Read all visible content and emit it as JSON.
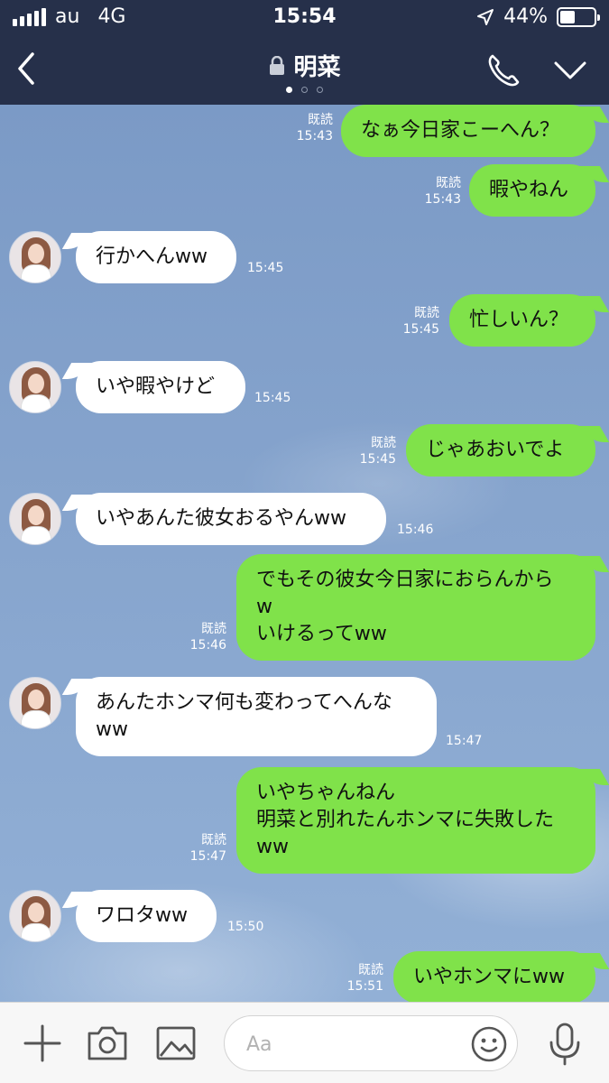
{
  "status": {
    "carrier": "au",
    "network": "4G",
    "time": "15:54",
    "battery": "44%",
    "battery_level": 0.44
  },
  "header": {
    "title": "明菜",
    "page_dots": 3,
    "active_dot": 0
  },
  "messages": [
    {
      "side": "out",
      "text": "なぁ今日家こーへん？",
      "read": "既読",
      "time": "15:43"
    },
    {
      "side": "out",
      "text": "暇やねん",
      "read": "既読",
      "time": "15:43"
    },
    {
      "side": "in",
      "text": "行かへんww",
      "time": "15:45"
    },
    {
      "side": "out",
      "text": "忙しいん？",
      "read": "既読",
      "time": "15:45"
    },
    {
      "side": "in",
      "text": "いや暇やけど",
      "time": "15:45"
    },
    {
      "side": "out",
      "text": "じゃあおいでよ",
      "read": "既読",
      "time": "15:45"
    },
    {
      "side": "in",
      "text": "いやあんた彼女おるやんww",
      "time": "15:46"
    },
    {
      "side": "out",
      "text": "でもその彼女今日家におらんから\nw\nいけるってww",
      "read": "既読",
      "time": "15:46"
    },
    {
      "side": "in",
      "text": "あんたホンマ何も変わってへんな\nww",
      "time": "15:47"
    },
    {
      "side": "out",
      "text": "いやちゃんねん\n明菜と別れたんホンマに失敗した\nww",
      "read": "既読",
      "time": "15:47"
    },
    {
      "side": "in",
      "text": "ワロタww",
      "time": "15:50"
    },
    {
      "side": "out",
      "text": "いやホンマにww",
      "read": "既読",
      "time": "15:51"
    }
  ],
  "input": {
    "placeholder": "Aa"
  },
  "colors": {
    "header": "#26304a",
    "out_bubble": "#80e24a",
    "in_bubble": "#ffffff"
  },
  "icons": [
    "back-icon",
    "lock-icon",
    "phone-icon",
    "chevron-down-icon",
    "plus-icon",
    "camera-icon",
    "image-icon",
    "emoji-icon",
    "mic-icon"
  ]
}
